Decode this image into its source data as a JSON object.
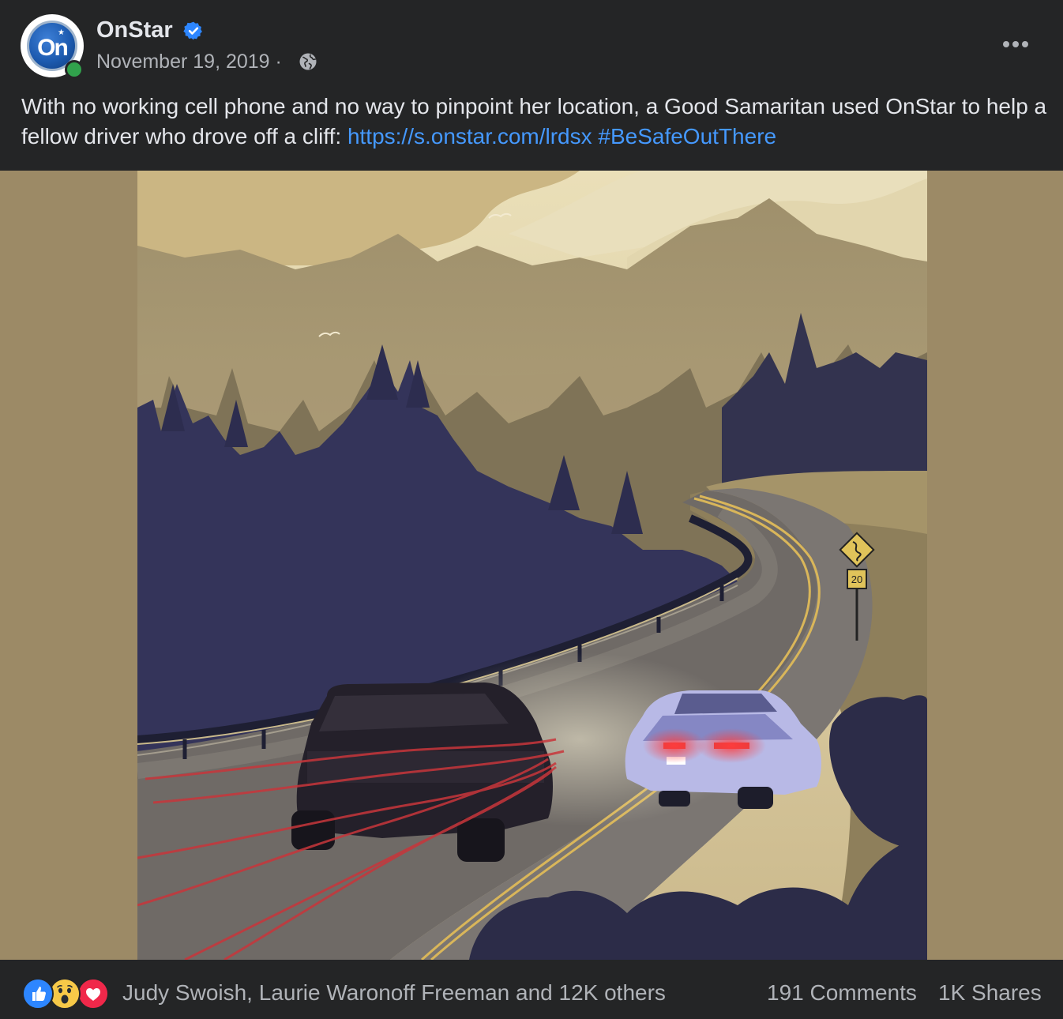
{
  "header": {
    "page_name": "OnStar",
    "avatar_text": "On",
    "date": "November 19, 2019",
    "separator": "·",
    "verified_icon": "verified-badge-icon",
    "privacy_icon": "globe-icon",
    "more_icon": "more-options-icon"
  },
  "message": {
    "text": "With no working cell phone and no way to pinpoint her location, a Good Samaritan used OnStar to help a fellow driver who drove off a cliff:",
    "link": "https://s.onstar.com/lrdsx",
    "hashtag": "#BeSafeOutThere"
  },
  "image": {
    "sign_speed": "20"
  },
  "footer": {
    "reactions": [
      "like-icon",
      "wow-icon",
      "love-icon"
    ],
    "reactors": "Judy Swoish, Laurie Waronoff Freeman and 12K others",
    "comments": "191 Comments",
    "shares": "1K Shares"
  },
  "colors": {
    "background": "#242526",
    "link": "#4599ff",
    "text": "#e4e6eb",
    "muted": "#b0b3b8",
    "image_backdrop": "#9c8a66"
  }
}
